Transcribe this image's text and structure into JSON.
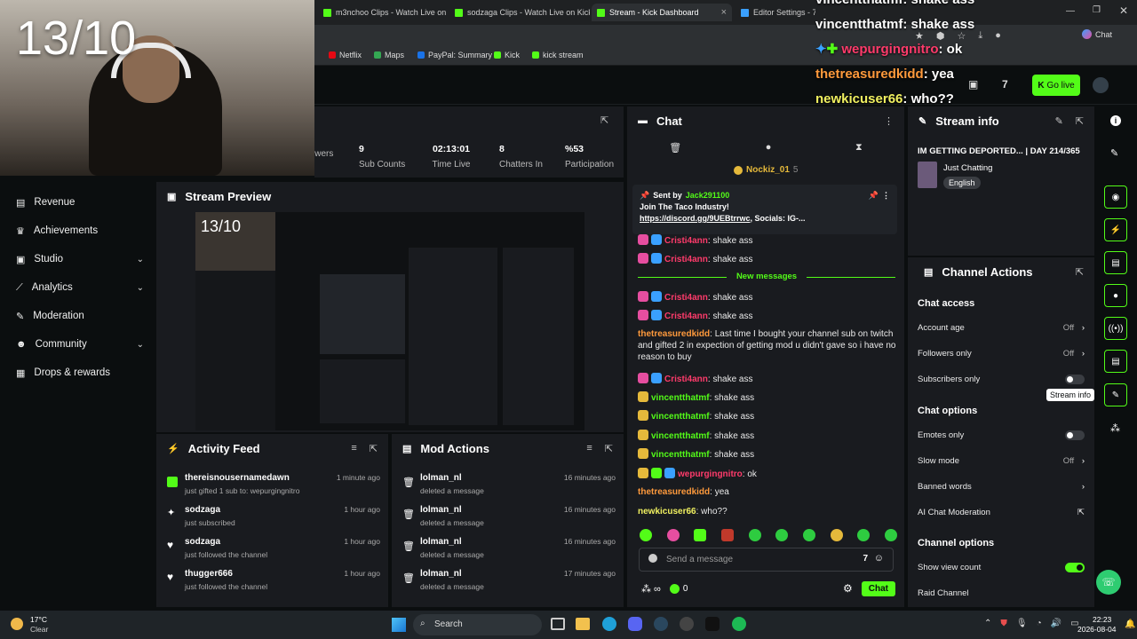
{
  "browser": {
    "tabs": [
      {
        "label": "m3nchoo Clips - Watch Live on Ki",
        "active": false
      },
      {
        "label": "sodzaga Clips - Watch Live on Kick",
        "active": false
      },
      {
        "label": "Stream - Kick Dashboard",
        "active": true
      },
      {
        "label": "Editor Settings - 7TV",
        "active": false
      }
    ],
    "bookmarks": [
      "Netflix",
      "Maps",
      "PayPal: Summary",
      "Kick",
      "kick stream"
    ],
    "chat_label": "Chat"
  },
  "overlay": {
    "score": "13/10",
    "chat": [
      {
        "user": "vincentthatmf",
        "text": "shake ass",
        "color": "#ffffff"
      },
      {
        "user": "wepurgingnitro",
        "text": "ok",
        "color": "#ff3b6b"
      },
      {
        "user": "thetreasuredkidd",
        "text": "yea",
        "color": "#ff9a3c"
      },
      {
        "user": "newkicuser66",
        "text": "who??",
        "color": "#f0f060"
      }
    ]
  },
  "topbar": {
    "go_live": "Go live"
  },
  "stats": [
    {
      "value": "",
      "label": "owers"
    },
    {
      "value": "9",
      "label": "Sub Counts"
    },
    {
      "value": "02:13:01",
      "label": "Time Live"
    },
    {
      "value": "8",
      "label": "Chatters In"
    },
    {
      "value": "%53",
      "label": "Participation"
    }
  ],
  "sidebar": {
    "items": [
      {
        "label": "Revenue",
        "icon": "receipt-icon",
        "expandable": false
      },
      {
        "label": "Achievements",
        "icon": "trophy-icon",
        "expandable": false
      },
      {
        "label": "Studio",
        "icon": "studio-icon",
        "expandable": true
      },
      {
        "label": "Analytics",
        "icon": "analytics-icon",
        "expandable": true
      },
      {
        "label": "Moderation",
        "icon": "wrench-icon",
        "expandable": false
      },
      {
        "label": "Community",
        "icon": "community-icon",
        "expandable": true
      },
      {
        "label": "Drops & rewards",
        "icon": "gift-icon",
        "expandable": false
      }
    ]
  },
  "preview": {
    "title": "Stream Preview"
  },
  "activity": {
    "title": "Activity Feed",
    "items": [
      {
        "name": "thereisnousernamedawn",
        "sub": "just gifted 1 sub to: wepurgingnitro",
        "time": "1 minute ago",
        "icon": "gift-icon"
      },
      {
        "name": "sodzaga",
        "sub": "just subscribed",
        "time": "1 hour ago",
        "icon": "star-icon"
      },
      {
        "name": "sodzaga",
        "sub": "just followed the channel",
        "time": "1 hour ago",
        "icon": "heart-icon"
      },
      {
        "name": "thugger666",
        "sub": "just followed the channel",
        "time": "1 hour ago",
        "icon": "heart-icon"
      }
    ]
  },
  "mod_actions": {
    "title": "Mod Actions",
    "items": [
      {
        "name": "lolman_nl",
        "sub": "deleted a message",
        "time": "16 minutes ago"
      },
      {
        "name": "lolman_nl",
        "sub": "deleted a message",
        "time": "16 minutes ago"
      },
      {
        "name": "lolman_nl",
        "sub": "deleted a message",
        "time": "16 minutes ago"
      },
      {
        "name": "lolman_nl",
        "sub": "deleted a message",
        "time": "17 minutes ago"
      }
    ]
  },
  "chat": {
    "title": "Chat",
    "top_user": "Nockiz_01",
    "top_count": "5",
    "pinned": {
      "sent_by_label": "Sent by",
      "sender": "Jack291100",
      "line1": "Join The Taco Industry!",
      "link": "https://discord.gg/9UEBtrrwc",
      "line2": ", Socials: IG-..."
    },
    "new_messages": "New messages",
    "messages": [
      {
        "user": "Cristi4ann",
        "text": "shake ass",
        "color": "#ff3b6b",
        "badge": "#e64ea0",
        "badge_text": "20"
      },
      {
        "user": "Cristi4ann",
        "text": "shake ass",
        "color": "#ff3b6b",
        "badge": "#e64ea0",
        "badge_text": "20"
      },
      {
        "user": "Cristi4ann",
        "text": "shake ass",
        "color": "#ff3b6b",
        "badge": "#e64ea0",
        "badge_text": "20"
      },
      {
        "user": "Cristi4ann",
        "text": "shake ass",
        "color": "#ff3b6b",
        "badge": "#e64ea0",
        "badge_text": "20"
      },
      {
        "user": "thetreasuredkidd",
        "text": "Last time I bought your channel sub on twitch and gifted 2 in expection of getting mod u didn't gave so i have no reason to buy",
        "color": "#ff9a3c",
        "badge": "",
        "badge_text": ""
      },
      {
        "user": "Cristi4ann",
        "text": "shake ass",
        "color": "#ff3b6b",
        "badge": "#e64ea0",
        "badge_text": "20"
      },
      {
        "user": "vincentthatmf",
        "text": "shake ass",
        "color": "#53fc18",
        "badge": "#e5b93b",
        "badge_text": "16"
      },
      {
        "user": "vincentthatmf",
        "text": "shake ass",
        "color": "#53fc18",
        "badge": "#e5b93b",
        "badge_text": "16"
      },
      {
        "user": "vincentthatmf",
        "text": "shake ass",
        "color": "#53fc18",
        "badge": "#e5b93b",
        "badge_text": "16"
      },
      {
        "user": "vincentthatmf",
        "text": "shake ass",
        "color": "#53fc18",
        "badge": "#e5b93b",
        "badge_text": "16"
      },
      {
        "user": "wepurgingnitro",
        "text": "ok",
        "color": "#ff3b6b",
        "badge": "#e5b93b",
        "badge_text": "13"
      },
      {
        "user": "thetreasuredkidd",
        "text": "yea",
        "color": "#ff9a3c",
        "badge": "",
        "badge_text": ""
      },
      {
        "user": "newkicuser66",
        "text": "who??",
        "color": "#f0f060",
        "badge": "",
        "badge_text": ""
      }
    ],
    "input_placeholder": "Send a message",
    "kick_count": "0",
    "send_label": "Chat"
  },
  "stream_info": {
    "title": "Stream info",
    "stream_title": "IM GETTING DEPORTED... | DAY 214/365",
    "category": "Just Chatting",
    "language": "English"
  },
  "channel_actions": {
    "title": "Channel Actions",
    "chat_access_label": "Chat access",
    "account_age": {
      "label": "Account age",
      "value": "Off"
    },
    "followers_only": {
      "label": "Followers only",
      "value": "Off"
    },
    "subscribers_only": {
      "label": "Subscribers only",
      "on": false
    },
    "chat_options_label": "Chat options",
    "emotes_only": {
      "label": "Emotes only",
      "on": false
    },
    "slow_mode": {
      "label": "Slow mode",
      "value": "Off"
    },
    "banned_words": {
      "label": "Banned words"
    },
    "ai_mod": {
      "label": "AI Chat Moderation"
    },
    "channel_options_label": "Channel options",
    "show_view_count": {
      "label": "Show view count",
      "on": true
    },
    "raid_channel": {
      "label": "Raid Channel"
    }
  },
  "rail": {
    "tooltip": "Stream info"
  },
  "taskbar": {
    "temp": "17°C",
    "weather": "Clear",
    "search": "Search",
    "time": "22:23",
    "date": "2026-08-04"
  },
  "colors": {
    "accent": "#53fc18",
    "panel": "#191b1f",
    "bg": "#0b0e0f"
  }
}
